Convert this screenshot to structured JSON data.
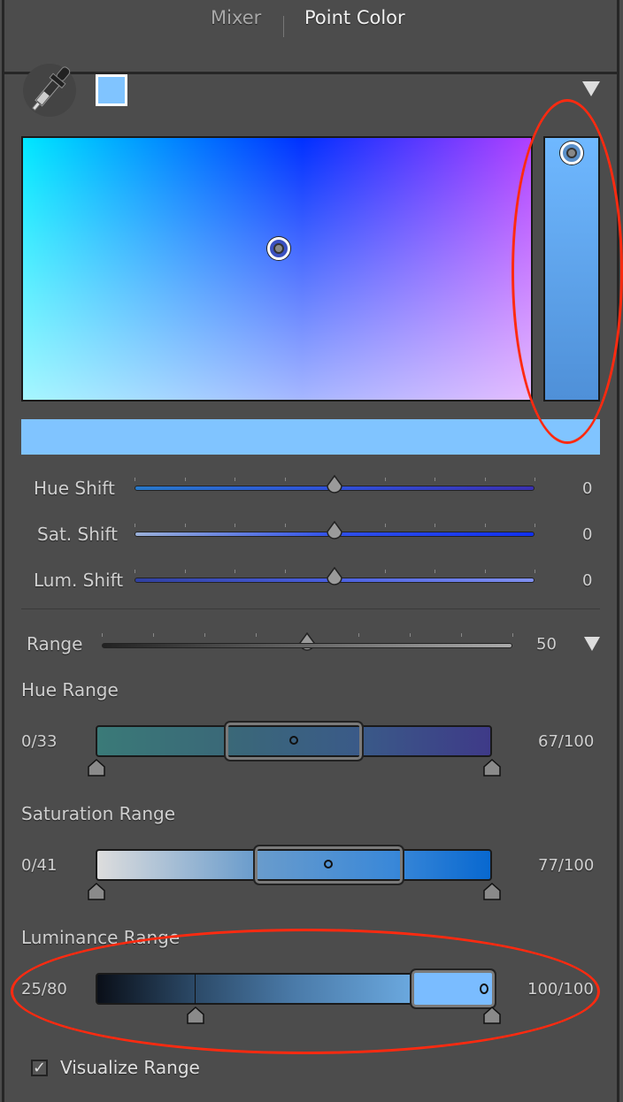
{
  "tabs": [
    {
      "label": "Mixer",
      "active": false
    },
    {
      "label": "Point Color",
      "active": true
    }
  ],
  "swatch_color": "#80c4ff",
  "colors": {
    "accent_annotation": "#ff2a10",
    "panel_bg": "#4c4c4c"
  },
  "shifts": [
    {
      "label": "Hue Shift",
      "value": "0"
    },
    {
      "label": "Sat. Shift",
      "value": "0"
    },
    {
      "label": "Lum. Shift",
      "value": "0"
    }
  ],
  "range": {
    "label": "Range",
    "value": "50"
  },
  "hue_range": {
    "label": "Hue Range",
    "left": "0/33",
    "right": "67/100"
  },
  "saturation_range": {
    "label": "Saturation Range",
    "left": "0/41",
    "right": "77/100"
  },
  "luminance_range": {
    "label": "Luminance Range",
    "left": "25/80",
    "right": "100/100"
  },
  "visualize": {
    "label": "Visualize Range",
    "checked": true
  }
}
